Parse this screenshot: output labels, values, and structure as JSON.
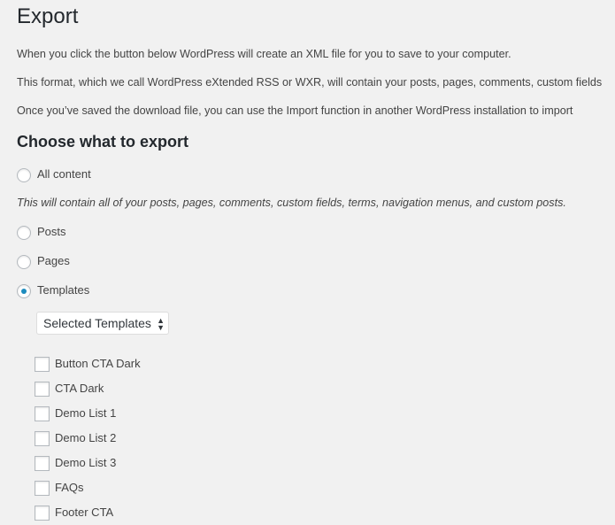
{
  "title": "Export",
  "intro": [
    "When you click the button below WordPress will create an XML file for you to save to your computer.",
    "This format, which we call WordPress eXtended RSS or WXR, will contain your posts, pages, comments, custom fields",
    "Once you’ve saved the download file, you can use the Import function in another WordPress installation to import"
  ],
  "choose_heading": "Choose what to export",
  "options": [
    {
      "label": "All content",
      "checked": false
    },
    {
      "label": "Posts",
      "checked": false
    },
    {
      "label": "Pages",
      "checked": false
    },
    {
      "label": "Templates",
      "checked": true
    }
  ],
  "all_content_description": "This will contain all of your posts, pages, comments, custom fields, terms, navigation menus, and custom posts.",
  "template_select": {
    "value": "Selected Templates"
  },
  "templates": [
    {
      "label": "Button CTA Dark",
      "checked": false
    },
    {
      "label": "CTA Dark",
      "checked": false
    },
    {
      "label": "Demo List 1",
      "checked": false
    },
    {
      "label": "Demo List 2",
      "checked": false
    },
    {
      "label": "Demo List 3",
      "checked": false
    },
    {
      "label": "FAQs",
      "checked": false
    },
    {
      "label": "Footer CTA",
      "checked": false
    }
  ]
}
